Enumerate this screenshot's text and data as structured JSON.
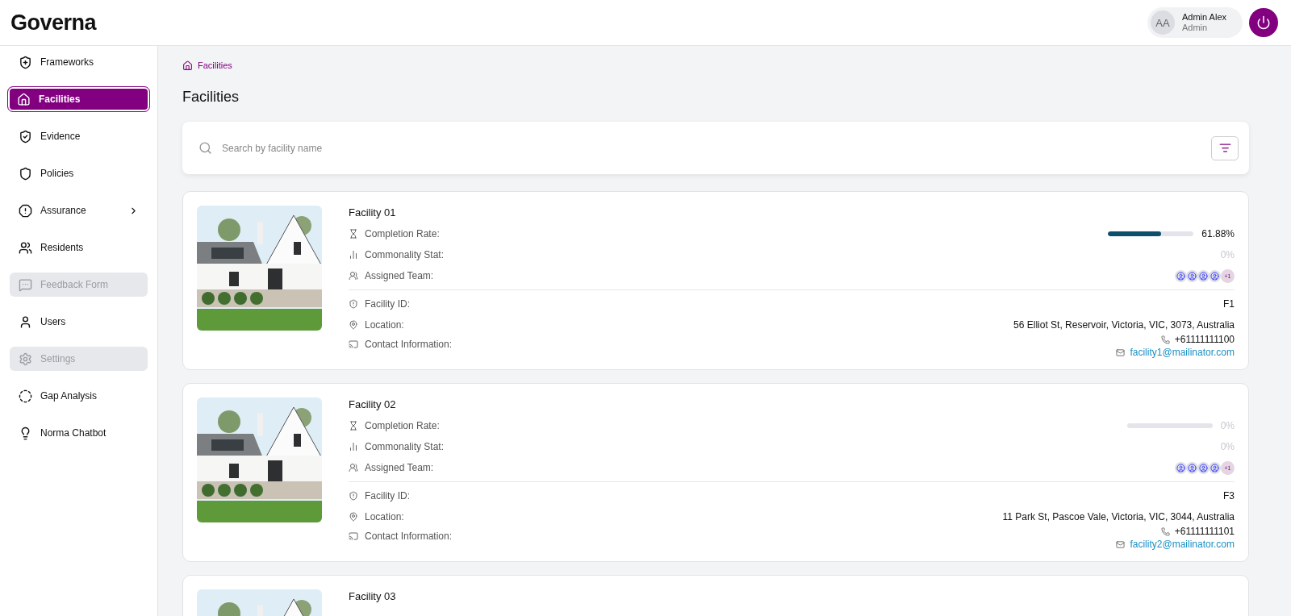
{
  "header": {
    "logo": "Governa",
    "user": {
      "initials": "AA",
      "name": "Admin Alex",
      "role": "Admin"
    }
  },
  "sidebar": {
    "items": [
      {
        "label": "Frameworks",
        "selected": false,
        "disabled": false
      },
      {
        "label": "Facilities",
        "selected": true,
        "disabled": false
      },
      {
        "label": "Evidence",
        "selected": false,
        "disabled": false
      },
      {
        "label": "Policies",
        "selected": false,
        "disabled": false
      },
      {
        "label": "Assurance",
        "selected": false,
        "disabled": false,
        "expandable": true
      },
      {
        "label": "Residents",
        "selected": false,
        "disabled": false
      },
      {
        "label": "Feedback Form",
        "selected": false,
        "disabled": true
      },
      {
        "label": "Users",
        "selected": false,
        "disabled": false
      },
      {
        "label": "Settings",
        "selected": false,
        "disabled": true
      },
      {
        "label": "Gap Analysis",
        "selected": false,
        "disabled": false
      },
      {
        "label": "Norma Chatbot",
        "selected": false,
        "disabled": false
      }
    ]
  },
  "breadcrumb": "Facilities",
  "page_title": "Facilities",
  "search": {
    "placeholder": "Search by facility name"
  },
  "facilities": [
    {
      "name": "Facility 01",
      "labels": {
        "completion": "Completion Rate:",
        "commonality": "Commonality Stat:",
        "team": "Assigned Team:",
        "id": "Facility ID:",
        "location": "Location:",
        "contact": "Contact Information:"
      },
      "completion": {
        "level": 0.6188,
        "reading": "61.88%"
      },
      "commonality": "0%",
      "team_more": "+1",
      "facility_id": "F1",
      "location": "56 Elliot St, Reservoir, Victoria, VIC, 3073, Australia",
      "phone": "+61111111100",
      "email": "facility1@mailinator.com"
    },
    {
      "name": "Facility 02",
      "labels": {
        "completion": "Completion Rate:",
        "commonality": "Commonality Stat:",
        "team": "Assigned Team:",
        "id": "Facility ID:",
        "location": "Location:",
        "contact": "Contact Information:"
      },
      "completion": {
        "level": 0,
        "reading": "0%"
      },
      "commonality": "0%",
      "team_more": "+1",
      "facility_id": "F3",
      "location": "11 Park St, Pascoe Vale, Victoria, VIC, 3044, Australia",
      "phone": "+61111111101",
      "email": "facility2@mailinator.com"
    },
    {
      "name": "Facility 03"
    }
  ]
}
